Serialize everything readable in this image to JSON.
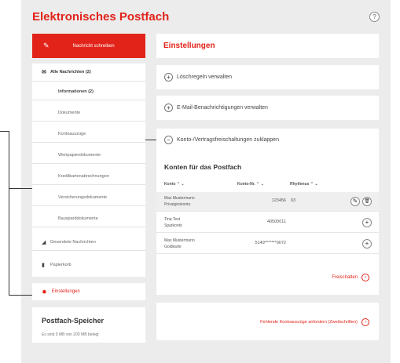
{
  "app": {
    "title": "Elektronisches Postfach",
    "help_icon": "?"
  },
  "compose": {
    "label": "Nachricht schreiben",
    "icon": "compose-icon"
  },
  "sidebar": {
    "items": [
      {
        "label": "Alle Nachrichten (2)",
        "icon": "envelope-icon"
      },
      {
        "label": "Informationen (2)"
      },
      {
        "label": "Dokumente"
      },
      {
        "label": "Kontoauszüge"
      },
      {
        "label": "Wertpapierdokumente"
      },
      {
        "label": "Kreditkartenabrechnungen"
      },
      {
        "label": "Versicherungsdokumente"
      },
      {
        "label": "Bausparddokumente"
      },
      {
        "label": "Gesendete Nachrichten",
        "icon": "send-icon"
      },
      {
        "label": "Papierkorb",
        "icon": "trash-icon"
      }
    ],
    "settings_label": "Einstellungen"
  },
  "storage": {
    "title": "Postfach-Speicher",
    "text": "Es sind 0 MB von 200 MB belegt"
  },
  "main": {
    "header": "Einstellungen",
    "accordions": [
      {
        "label": "Löschregeln verwalten",
        "symbol": "+"
      },
      {
        "label": "E-Mail-Benachrichtigungen verwalten",
        "symbol": "+"
      },
      {
        "label": "Konto-/Vertragsfreischaltungen zuklappen",
        "symbol": "−"
      }
    ],
    "konten_title": "Konten für das Postfach",
    "table": {
      "headers": [
        "Konto ⌃ ⌄",
        "Konto-Nr. ⌃ ⌄",
        "Rhythmus ⌃ ⌄"
      ],
      "rows": [
        {
          "name_line1": "Max Mustermann",
          "name_line2": "Privatgirokonto",
          "nr": "123456",
          "rhythm": "03",
          "actions": [
            "edit",
            "delete"
          ]
        },
        {
          "name_line1": "Tina Test",
          "name_line2": "Sparkonto",
          "nr": "40500011",
          "rhythm": "",
          "actions": [
            "add"
          ]
        },
        {
          "name_line1": "Max Mustermann",
          "name_line2": "Goldkarte",
          "nr": "5149*******0072",
          "rhythm": "",
          "actions": [
            "add"
          ]
        }
      ]
    },
    "freischalten_label": "Freischalten",
    "order_label": "Fehlende Kontoauszüge anfordern (Zweitschriften)"
  },
  "colors": {
    "accent": "#e2231a",
    "panel": "#ffffff",
    "background": "#ececec"
  }
}
